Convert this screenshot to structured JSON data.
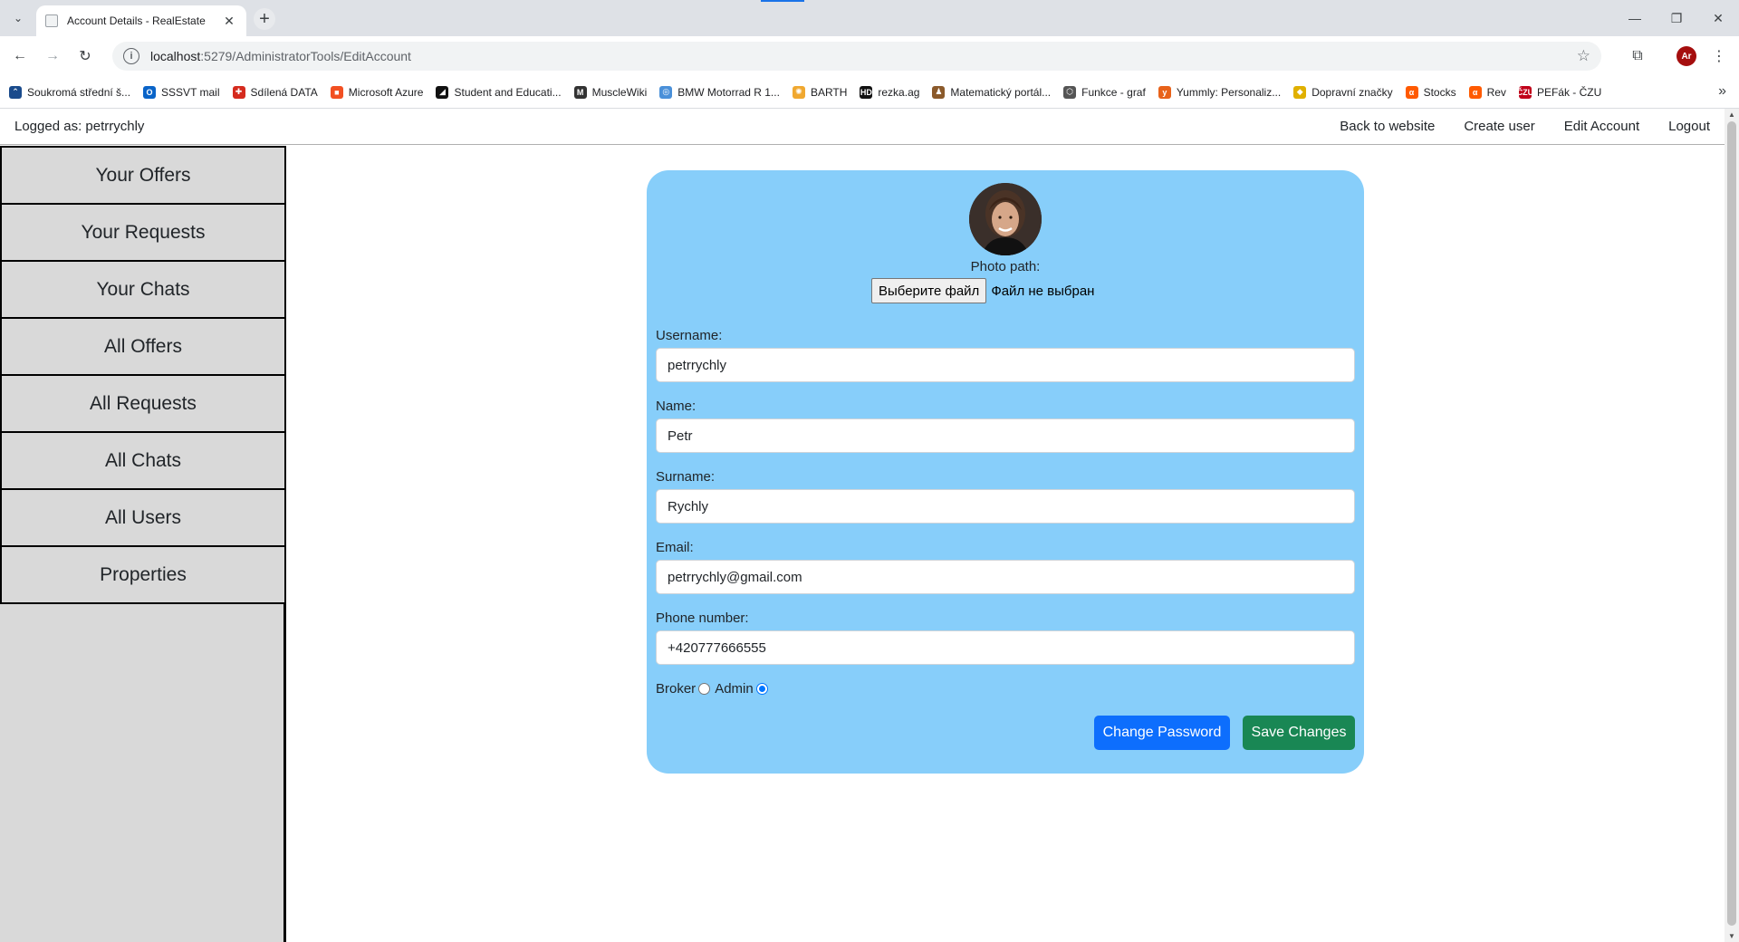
{
  "browser": {
    "tab_title": "Account Details - RealEstate",
    "url_host": "localhost",
    "url_rest": ":5279/AdministratorTools/EditAccount",
    "profile_initials": "Ar",
    "bookmarks": [
      {
        "label": "Soukromá střední š...",
        "color": "#1a4b8c",
        "glyph": "⌃"
      },
      {
        "label": "SSSVT mail",
        "color": "#0a64c8",
        "glyph": "O"
      },
      {
        "label": "Sdílená DATA",
        "color": "#d52b1e",
        "glyph": "✚"
      },
      {
        "label": "Microsoft Azure",
        "color": "#f25022",
        "glyph": "■"
      },
      {
        "label": "Student and Educati...",
        "color": "#111111",
        "glyph": "◢"
      },
      {
        "label": "MuscleWiki",
        "color": "#333333",
        "glyph": "M"
      },
      {
        "label": "BMW Motorrad R 1...",
        "color": "#4a90d9",
        "glyph": "◎"
      },
      {
        "label": "BARTH",
        "color": "#f0a830",
        "glyph": "✺"
      },
      {
        "label": "rezka.ag",
        "color": "#111111",
        "glyph": "HD"
      },
      {
        "label": "Matematický portál...",
        "color": "#8b5a2b",
        "glyph": "♟"
      },
      {
        "label": "Funkce - graf",
        "color": "#555555",
        "glyph": "⬡"
      },
      {
        "label": "Yummly: Personaliz...",
        "color": "#e8621a",
        "glyph": "y"
      },
      {
        "label": "Dopravní značky",
        "color": "#e0b000",
        "glyph": "◆"
      },
      {
        "label": "Stocks",
        "color": "#ff5a00",
        "glyph": "α"
      },
      {
        "label": "Rev",
        "color": "#ff5a00",
        "glyph": "α"
      },
      {
        "label": "PEFák - ČZU",
        "color": "#c0001a",
        "glyph": "ČZU"
      }
    ]
  },
  "topnav": {
    "logged_as": "Logged as: petrrychly",
    "links": [
      "Back to website",
      "Create user",
      "Edit Account",
      "Logout"
    ]
  },
  "sidebar": {
    "items": [
      "Your Offers",
      "Your Requests",
      "Your Chats",
      "All Offers",
      "All Requests",
      "All Chats",
      "All Users",
      "Properties"
    ]
  },
  "form": {
    "photo_label": "Photo path:",
    "file_button": "Выберите файл",
    "file_status": "Файл не выбран",
    "fields": [
      {
        "label": "Username:",
        "value": "petrrychly"
      },
      {
        "label": "Name:",
        "value": "Petr"
      },
      {
        "label": "Surname:",
        "value": "Rychly"
      },
      {
        "label": "Email:",
        "value": "petrrychly@gmail.com"
      },
      {
        "label": "Phone number:",
        "value": "+420777666555"
      }
    ],
    "roles": {
      "broker_label": "Broker",
      "admin_label": "Admin",
      "selected": "Admin"
    },
    "change_password": "Change Password",
    "save_changes": "Save Changes"
  },
  "colors": {
    "card": "#87cefa",
    "primary": "#0d6efd",
    "success": "#198754",
    "sidebar": "#d9d9d9"
  }
}
